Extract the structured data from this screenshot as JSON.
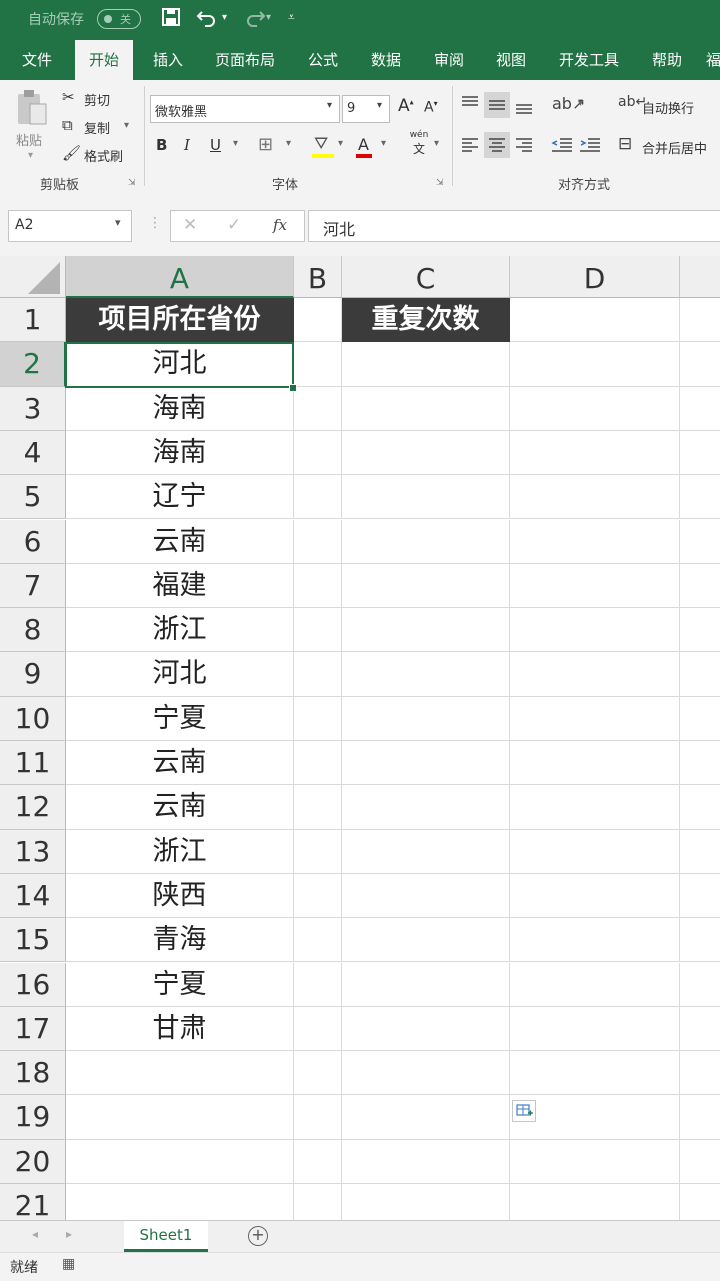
{
  "titlebar": {
    "autosave_label": "自动保存",
    "autosave_state": "关"
  },
  "tabs": [
    {
      "label": "文件",
      "active": false
    },
    {
      "label": "开始",
      "active": true
    },
    {
      "label": "插入",
      "active": false
    },
    {
      "label": "页面布局",
      "active": false
    },
    {
      "label": "公式",
      "active": false
    },
    {
      "label": "数据",
      "active": false
    },
    {
      "label": "审阅",
      "active": false
    },
    {
      "label": "视图",
      "active": false
    },
    {
      "label": "开发工具",
      "active": false
    },
    {
      "label": "帮助",
      "active": false
    },
    {
      "label": "福",
      "active": false
    }
  ],
  "ribbon": {
    "clipboard": {
      "paste": "粘贴",
      "cut": "剪切",
      "copy": "复制",
      "format_painter": "格式刷",
      "group_label": "剪贴板"
    },
    "font": {
      "font_name": "微软雅黑",
      "font_size": "9",
      "bold": "B",
      "italic": "I",
      "underline": "U",
      "font_color": "A",
      "phonetic": "wén",
      "phonetic_sub": "文",
      "group_label": "字体"
    },
    "alignment": {
      "wrap_text": "自动换行",
      "merge_center": "合并后居中",
      "group_label": "对齐方式"
    }
  },
  "formula_bar": {
    "name_box": "A2",
    "fx": "fx",
    "content": "河北"
  },
  "columns": [
    "A",
    "B",
    "C",
    "D"
  ],
  "rows": [
    "1",
    "2",
    "3",
    "4",
    "5",
    "6",
    "7",
    "8",
    "9",
    "10",
    "11",
    "12",
    "13",
    "14",
    "15",
    "16",
    "17",
    "18",
    "19",
    "20",
    "21"
  ],
  "cells": {
    "A1": "项目所在省份",
    "C1": "重复次数",
    "A_values": [
      "河北",
      "海南",
      "海南",
      "辽宁",
      "云南",
      "福建",
      "浙江",
      "河北",
      "宁夏",
      "云南",
      "云南",
      "浙江",
      "陕西",
      "青海",
      "宁夏",
      "甘肃"
    ]
  },
  "sheet_tabs": [
    "Sheet1"
  ],
  "status": "就绪",
  "colors": {
    "excel_green": "#217346",
    "header_fill": "#3b3b3b"
  }
}
